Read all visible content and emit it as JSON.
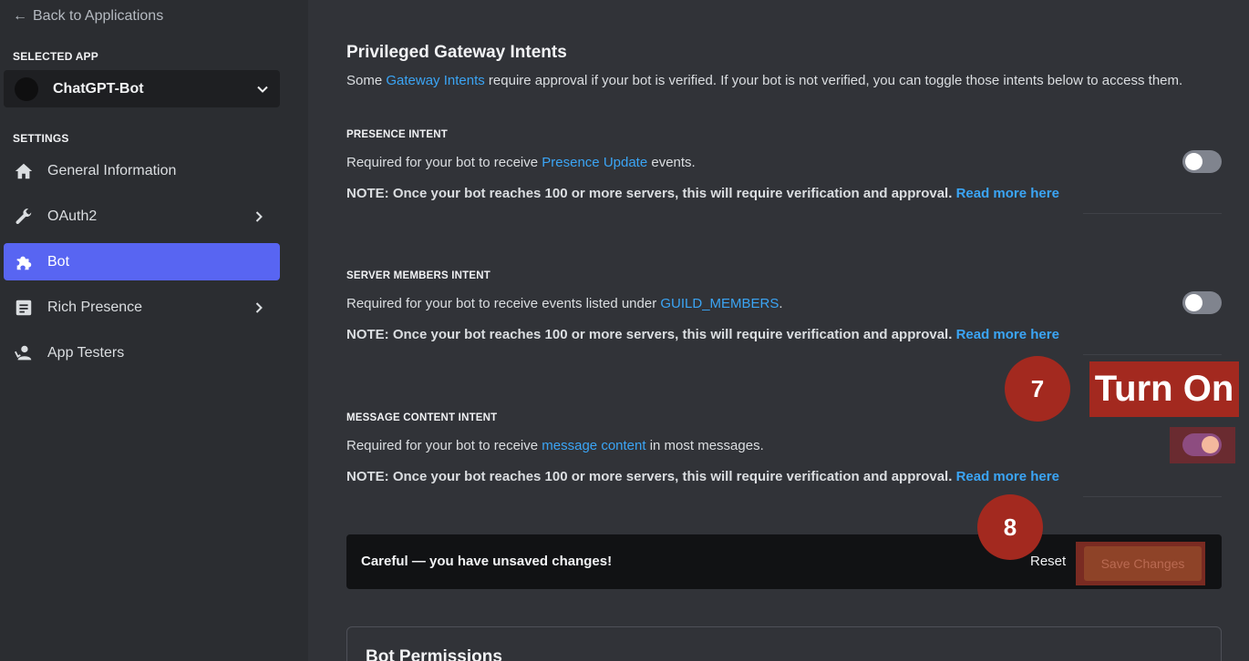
{
  "sidebar": {
    "back_label": "Back to Applications",
    "selected_app_label": "SELECTED APP",
    "app_name": "ChatGPT-Bot",
    "settings_label": "SETTINGS",
    "items": [
      {
        "label": "General Information",
        "icon": "home-icon"
      },
      {
        "label": "OAuth2",
        "icon": "wrench-icon"
      },
      {
        "label": "Bot",
        "icon": "puzzle-icon",
        "active": true
      },
      {
        "label": "Rich Presence",
        "icon": "document-icon"
      },
      {
        "label": "App Testers",
        "icon": "person-icon"
      }
    ]
  },
  "main": {
    "title": "Privileged Gateway Intents",
    "desc_pre": "Some ",
    "desc_link": "Gateway Intents",
    "desc_post": " require approval if your bot is verified. If your bot is not verified, you can toggle those intents below to access them.",
    "intents": [
      {
        "title": "PRESENCE INTENT",
        "desc_pre": "Required for your bot to receive ",
        "desc_link": "Presence Update",
        "desc_post": " events.",
        "note": "NOTE: Once your bot reaches 100 or more servers, this will require verification and approval.",
        "note_link": "Read more here",
        "enabled": false
      },
      {
        "title": "SERVER MEMBERS INTENT",
        "desc_pre": "Required for your bot to receive events listed under ",
        "desc_link": "GUILD_MEMBERS",
        "desc_post": ".",
        "note": "NOTE: Once your bot reaches 100 or more servers, this will require verification and approval.",
        "note_link": "Read more here",
        "enabled": false
      },
      {
        "title": "MESSAGE CONTENT INTENT",
        "desc_pre": "Required for your bot to receive ",
        "desc_link": "message content",
        "desc_post": " in most messages.",
        "note": "NOTE: Once your bot reaches 100 or more servers, this will require verification and approval.",
        "note_link": "Read more here",
        "enabled": true
      }
    ],
    "savebar": {
      "message": "Careful — you have unsaved changes!",
      "reset_label": "Reset",
      "save_label": "Save Changes"
    },
    "permissions_title": "Bot Permissions"
  },
  "annotations": {
    "step7": "7",
    "step7_label": "Turn On",
    "step8": "8"
  },
  "colors": {
    "accent": "#5865f2",
    "link": "#3ba5f5",
    "annotation": "#a3291f"
  }
}
